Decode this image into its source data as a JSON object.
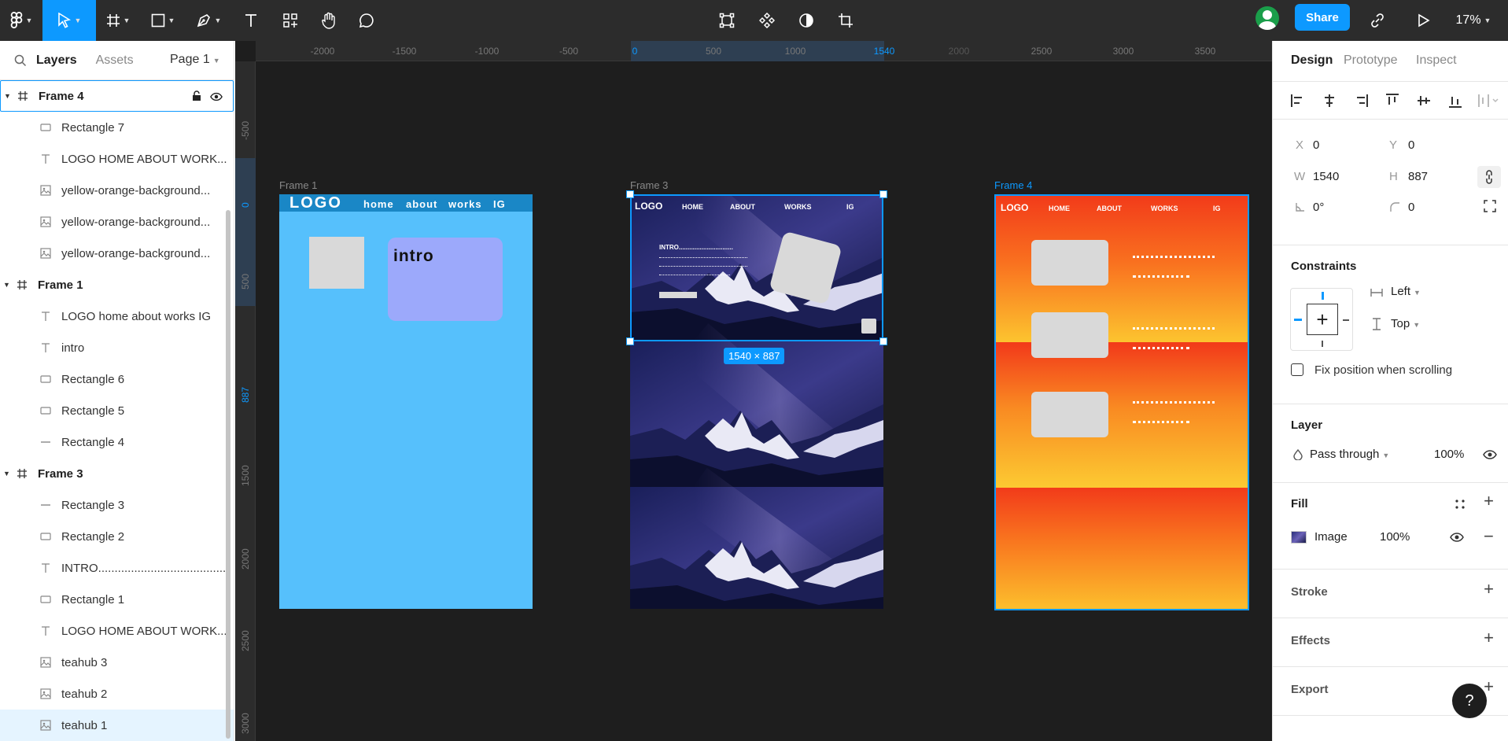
{
  "toolbar": {
    "share_label": "Share",
    "zoom_label": "17%",
    "tools": [
      "figma-menu",
      "move",
      "frame",
      "shape",
      "pen",
      "text",
      "resources",
      "hand",
      "comment"
    ],
    "center_tools": [
      "transform",
      "component",
      "mask",
      "crop"
    ]
  },
  "left_panel": {
    "tabs": {
      "layers": "Layers",
      "assets": "Assets"
    },
    "page_selector": "Page 1",
    "layers": [
      {
        "name": "Frame 4",
        "kind": "frame",
        "icon": "frame-icon"
      },
      {
        "name": "Rectangle 7",
        "kind": "child",
        "icon": "rectangle-icon"
      },
      {
        "name": "LOGO HOME ABOUT WORK...",
        "kind": "child",
        "icon": "text-icon"
      },
      {
        "name": "yellow-orange-background...",
        "kind": "child",
        "icon": "image-icon"
      },
      {
        "name": "yellow-orange-background...",
        "kind": "child",
        "icon": "image-icon"
      },
      {
        "name": "yellow-orange-background...",
        "kind": "child",
        "icon": "image-icon"
      },
      {
        "name": "Frame 1",
        "kind": "frame",
        "icon": "frame-icon"
      },
      {
        "name": "LOGO home about works IG",
        "kind": "child",
        "icon": "text-icon"
      },
      {
        "name": "intro",
        "kind": "child",
        "icon": "text-icon"
      },
      {
        "name": "Rectangle 6",
        "kind": "child",
        "icon": "rectangle-icon"
      },
      {
        "name": "Rectangle 5",
        "kind": "child",
        "icon": "rectangle-icon"
      },
      {
        "name": "Rectangle 4",
        "kind": "child",
        "icon": "line-icon"
      },
      {
        "name": "Frame 3",
        "kind": "frame",
        "icon": "frame-icon"
      },
      {
        "name": "Rectangle 3",
        "kind": "child",
        "icon": "line-icon"
      },
      {
        "name": "Rectangle 2",
        "kind": "child",
        "icon": "rectangle-icon"
      },
      {
        "name": "INTRO........................................",
        "kind": "child",
        "icon": "text-icon"
      },
      {
        "name": "Rectangle 1",
        "kind": "child",
        "icon": "rectangle-icon"
      },
      {
        "name": "LOGO HOME ABOUT WORK...",
        "kind": "child",
        "icon": "text-icon"
      },
      {
        "name": "teahub 3",
        "kind": "child",
        "icon": "image-icon"
      },
      {
        "name": "teahub 2",
        "kind": "child",
        "icon": "image-icon"
      },
      {
        "name": "teahub 1",
        "kind": "child",
        "icon": "image-icon"
      }
    ]
  },
  "canvas": {
    "ruler_h": [
      "-2000",
      "-1500",
      "-1000",
      "-500",
      "0",
      "500",
      "1000",
      "1540",
      "2000",
      "2500",
      "3000",
      "3500"
    ],
    "ruler_v": [
      "-500",
      "0",
      "500",
      "887",
      "1500",
      "2000",
      "2500",
      "3000"
    ],
    "frame1": {
      "label": "Frame 1",
      "logo": "LOGO",
      "nav": [
        "home",
        "about",
        "works",
        "IG"
      ],
      "intro": "intro"
    },
    "frame3": {
      "label": "Frame 3",
      "logo": "LOGO",
      "nav": [
        "HOME",
        "ABOUT",
        "WORKS",
        "IG"
      ],
      "intro": "INTRO...............................",
      "size_badge": "1540 × 887"
    },
    "frame4": {
      "label": "Frame 4",
      "logo": "LOGO",
      "nav": [
        "HOME",
        "ABOUT",
        "WORKS",
        "IG"
      ]
    }
  },
  "right_panel": {
    "tabs": {
      "design": "Design",
      "prototype": "Prototype",
      "inspect": "Inspect"
    },
    "x_label": "X",
    "x": "0",
    "y_label": "Y",
    "y": "0",
    "w_label": "W",
    "w": "1540",
    "h_label": "H",
    "h": "887",
    "rotation": "0°",
    "radius": "0",
    "constraints_title": "Constraints",
    "constraint_h": "Left",
    "constraint_v": "Top",
    "fix_scroll": "Fix position when scrolling",
    "layer_title": "Layer",
    "blend": "Pass through",
    "opacity": "100%",
    "fill_title": "Fill",
    "fill_type": "Image",
    "fill_opacity": "100%",
    "stroke_title": "Stroke",
    "effects_title": "Effects",
    "export_title": "Export",
    "help": "?"
  },
  "colors": {
    "accent": "#0d99ff",
    "toolbar_bg": "#2c2c2c",
    "canvas_bg": "#1e1e1e",
    "frame1_bg": "#56c0fc",
    "frame1_header": "#1a87c6",
    "intro_box": "#9ca9fb"
  }
}
